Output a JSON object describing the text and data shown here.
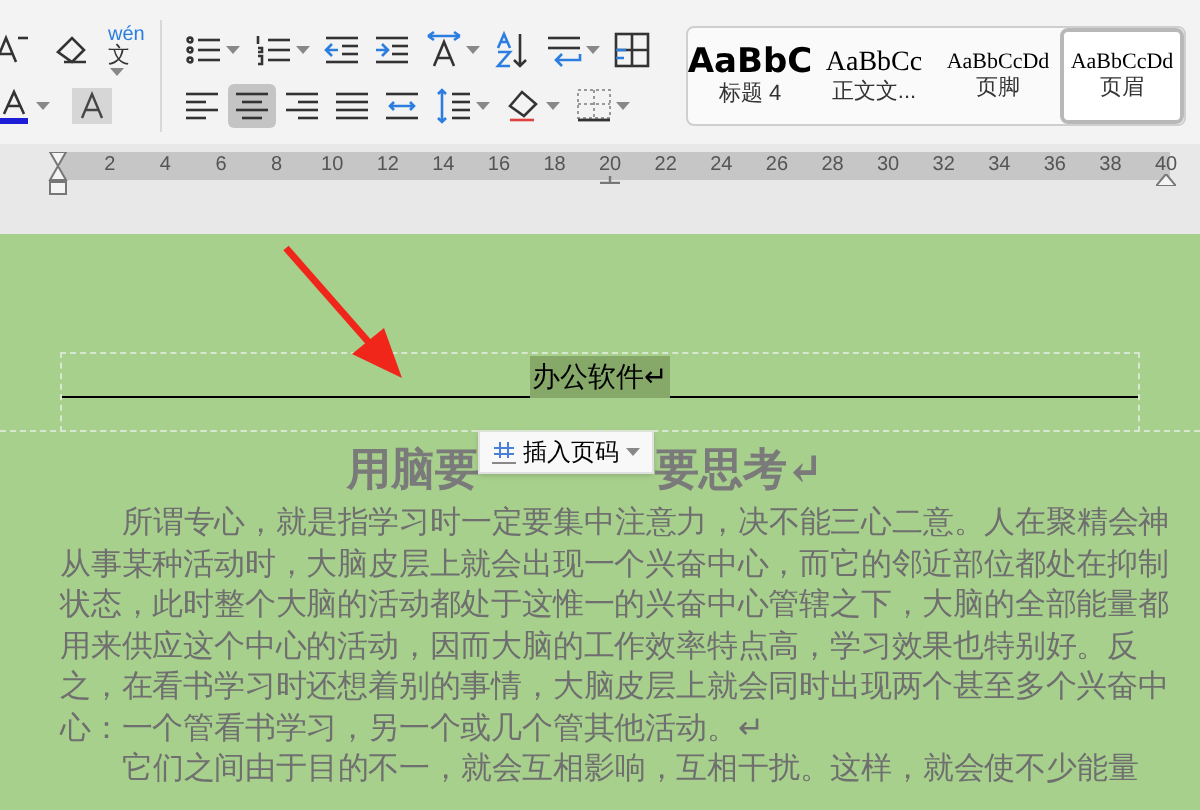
{
  "ribbon": {
    "font_tools": {
      "row1": [
        {
          "kind": "shrink-font",
          "dropdown": false
        },
        {
          "kind": "clear-format",
          "dropdown": false
        },
        {
          "kind": "phonetic",
          "top": "wén",
          "bottom": "文",
          "dropdown": true
        }
      ],
      "row2": [
        {
          "kind": "font-color",
          "dropdown": true
        },
        {
          "kind": "char-shading",
          "dropdown": false
        }
      ]
    },
    "paragraph_tools": {
      "row1": [
        {
          "kind": "bullets",
          "dropdown": true,
          "selected": false
        },
        {
          "kind": "numbering",
          "dropdown": true,
          "selected": false
        },
        {
          "kind": "indent-decrease",
          "dropdown": false,
          "selected": false
        },
        {
          "kind": "indent-increase",
          "dropdown": false,
          "selected": false
        },
        {
          "kind": "char-scale",
          "dropdown": true,
          "selected": false
        },
        {
          "kind": "sort",
          "dropdown": false,
          "selected": false
        },
        {
          "kind": "para-spacing",
          "dropdown": true,
          "selected": false
        },
        {
          "kind": "table-grid",
          "dropdown": false,
          "selected": false
        }
      ],
      "row2": [
        {
          "kind": "align-left",
          "dropdown": false,
          "selected": false
        },
        {
          "kind": "align-center",
          "dropdown": false,
          "selected": true
        },
        {
          "kind": "align-right",
          "dropdown": false,
          "selected": false
        },
        {
          "kind": "justify",
          "dropdown": false,
          "selected": false
        },
        {
          "kind": "distribute",
          "dropdown": false,
          "selected": false
        },
        {
          "kind": "line-spacing",
          "dropdown": true,
          "selected": false
        },
        {
          "kind": "fill",
          "dropdown": true,
          "selected": false
        },
        {
          "kind": "borders",
          "dropdown": true,
          "selected": false
        }
      ]
    },
    "styles": [
      {
        "kind": "heading",
        "sample": "AaBbC",
        "label": "标题 4",
        "selected": false
      },
      {
        "kind": "body",
        "sample": "AaBbCc",
        "label": "正文文...",
        "selected": false
      },
      {
        "kind": "small",
        "sample": "AaBbCcDd",
        "label": "页脚",
        "selected": false
      },
      {
        "kind": "small",
        "sample": "AaBbCcDd",
        "label": "页眉",
        "selected": true
      }
    ]
  },
  "ruler": {
    "ticks": [
      "2",
      "4",
      "6",
      "8",
      "10",
      "12",
      "14",
      "16",
      "18",
      "20",
      "22",
      "24",
      "26",
      "28",
      "30",
      "32",
      "34",
      "36",
      "38",
      "40"
    ]
  },
  "header": {
    "text": "办公软件",
    "mark": "↵",
    "selected": true
  },
  "insert_page_number_button": {
    "label": "插入页码"
  },
  "document": {
    "title_left": "用脑要",
    "title_right": "要思考↵",
    "paragraphs": [
      "所谓专心，就是指学习时一定要集中注意力，决不能三心二意。人在聚精会神从事某种活动时，大脑皮层上就会出现一个兴奋中心，而它的邻近部位都处在抑制状态，此时整个大脑的活动都处于这惟一的兴奋中心管辖之下，大脑的全部能量都用来供应这个中心的活动，因而大脑的工作效率特点高，学习效果也特别好。反之，在看书学习时还想着别的事情，大脑皮层上就会同时出现两个甚至多个兴奋中心：一个管看书学习，另一个或几个管其他活动。↵",
      "它们之间由于目的不一，就会互相影响，互相干扰。这样，就会使不少能量"
    ]
  }
}
